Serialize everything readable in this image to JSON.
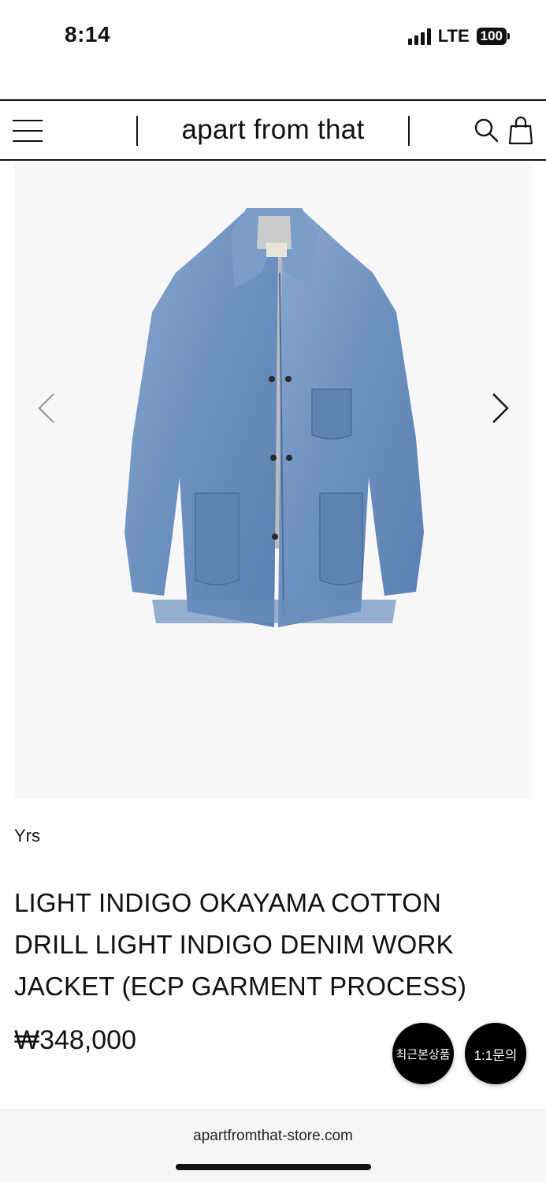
{
  "status_bar": {
    "time": "8:14",
    "network": "LTE",
    "battery": "100"
  },
  "header": {
    "logo": "apart from that",
    "menu_icon": "hamburger-menu-icon",
    "search_icon": "search-icon",
    "cart_icon": "shopping-bag-icon"
  },
  "gallery": {
    "prev_icon": "chevron-left-icon",
    "next_icon": "chevron-right-icon",
    "image": "denim-jacket-image",
    "label_tag": "Yrs"
  },
  "product": {
    "brand": "Yrs",
    "title": "LIGHT INDIGO OKAYAMA COTTON DRILL LIGHT INDIGO DENIM WORK JACKET (ECP GARMENT PROCESS)",
    "price": "₩348,000"
  },
  "floating_buttons": {
    "recent": "최근본상품",
    "inquiry": "1:1문의"
  },
  "browser": {
    "url": "apartfromthat-store.com"
  },
  "colors": {
    "text": "#111111",
    "background": "#ffffff",
    "image_background": "#f7f7f9",
    "denim": "#6f93c0",
    "float_button": "#000000"
  }
}
